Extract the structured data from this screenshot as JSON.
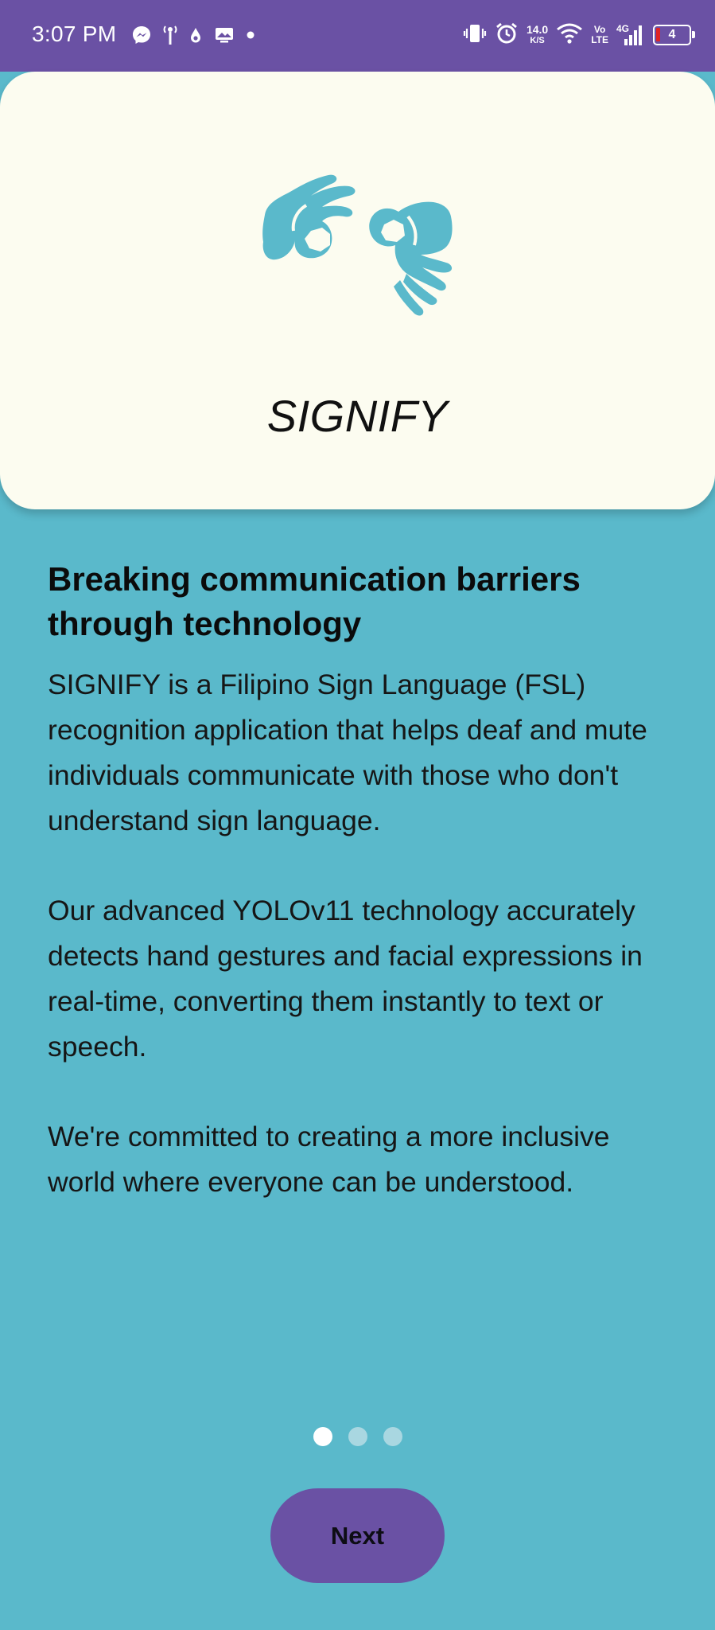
{
  "status_bar": {
    "time": "3:07 PM",
    "net_speed_value": "14.0",
    "net_speed_unit": "K/S",
    "volte_top": "Vo",
    "volte_bottom": "LTE",
    "network_type": "4G",
    "battery_level": "4",
    "left_icons": [
      "messenger-icon",
      "tower-icon",
      "drop-icon",
      "gallery-icon",
      "dot-icon"
    ],
    "right_icons": [
      "vibrate-icon",
      "alarm-icon",
      "wifi-icon",
      "signal-icon",
      "battery-icon"
    ]
  },
  "header": {
    "app_name": "SIGNIFY",
    "logo_icon": "sign-language-hands-icon",
    "logo_color": "#5ab9cb"
  },
  "content": {
    "headline": "Breaking communication barriers through technology",
    "paragraphs": [
      "SIGNIFY is a Filipino Sign Language (FSL) recognition application that helps deaf and mute individuals communicate with those who don't understand sign language.",
      "Our advanced YOLOv11 technology accurately detects hand gestures and facial expressions in real-time, converting them instantly to text or speech.",
      "We're committed to creating a more inclusive world where everyone can be understood."
    ]
  },
  "pager": {
    "total_pages": 3,
    "current_page": 1
  },
  "actions": {
    "next_label": "Next"
  },
  "colors": {
    "background": "#5ab9cb",
    "status_bar": "#6a51a4",
    "card": "#fcfcf0",
    "button": "#6a51a4",
    "dot_active": "#ffffff",
    "dot_inactive": "#a9d7e1"
  }
}
